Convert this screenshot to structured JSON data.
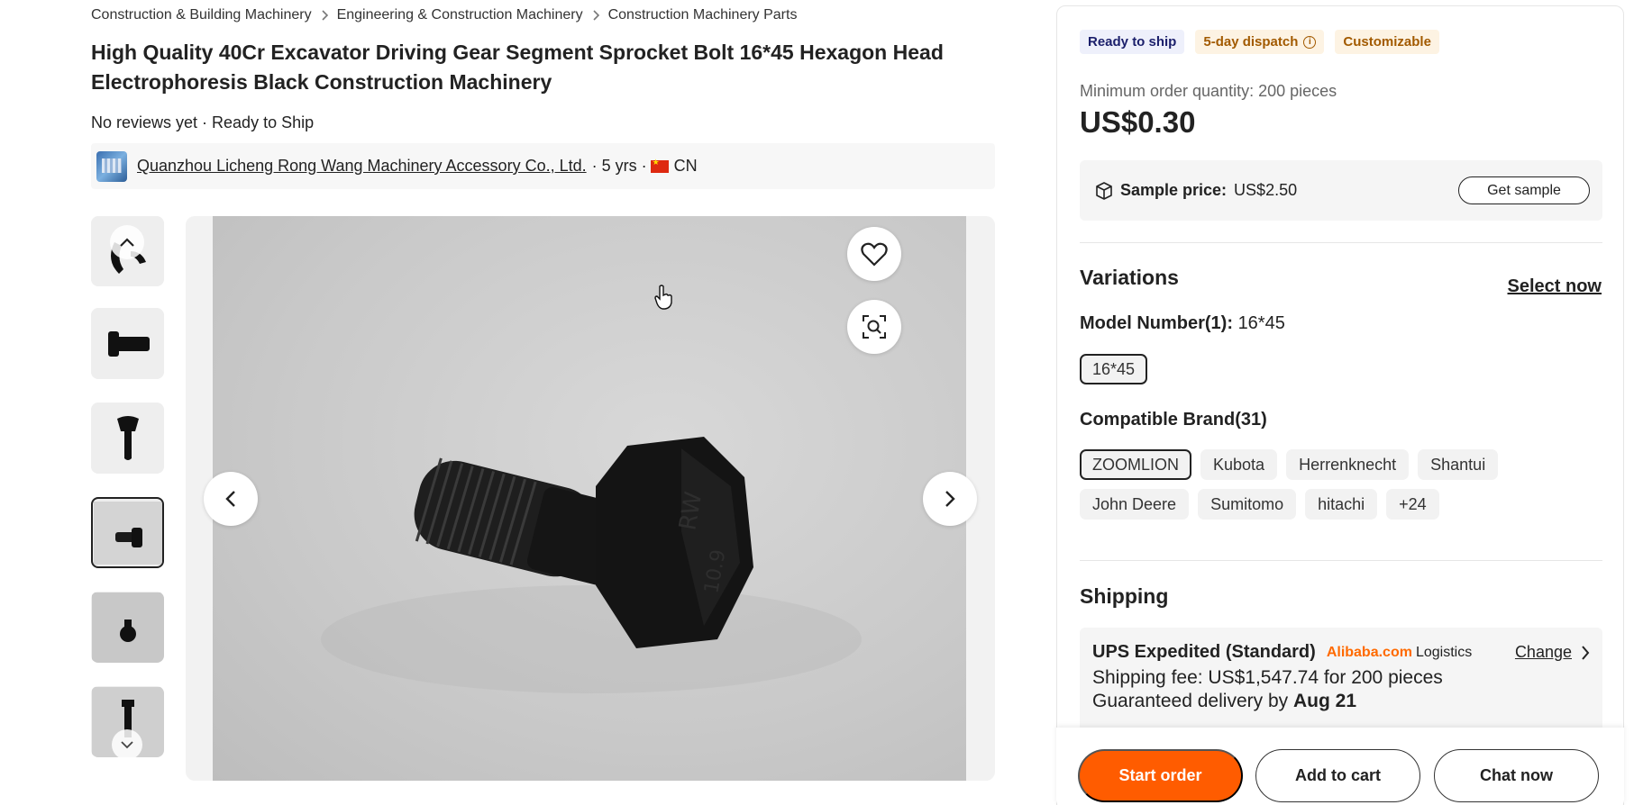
{
  "breadcrumb": [
    "Construction & Building Machinery",
    "Engineering & Construction Machinery",
    "Construction Machinery Parts"
  ],
  "product": {
    "title": "High Quality 40Cr Excavator Driving Gear Segment Sprocket Bolt 16*45 Hexagon Head Electrophoresis Black Construction Machinery",
    "reviews": "No reviews yet · Ready to Ship"
  },
  "supplier": {
    "name": "Quanzhou Licheng Rong Wang Machinery Accessory Co., Ltd.",
    "meta_years": "· 5 yrs ·",
    "country": "CN"
  },
  "gallery": {
    "favorite_icon": "heart-icon",
    "image_search_icon": "image-search-icon",
    "thumbnails_count": 6,
    "active_thumbnail": 4
  },
  "panel": {
    "badges": {
      "ready": "Ready to ship",
      "dispatch": "5-day dispatch",
      "custom": "Customizable"
    },
    "moq": "Minimum order quantity: 200 pieces",
    "price": "US$0.30",
    "sample": {
      "label": "Sample price:",
      "value": "US$2.50",
      "button": "Get sample"
    },
    "variations": {
      "title": "Variations",
      "select_now": "Select now",
      "model_label": "Model Number(1):",
      "model_value": "16*45",
      "models": [
        "16*45"
      ],
      "brand_label": "Compatible Brand(31)",
      "brands": [
        "ZOOMLION",
        "Kubota",
        "Herrenknecht",
        "Shantui",
        "John Deere",
        "Sumitomo",
        "hitachi",
        "+24"
      ]
    },
    "shipping": {
      "title": "Shipping",
      "method": "UPS Expedited (Standard)",
      "brand": "Alibaba.com",
      "brand_suffix": "Logistics",
      "change": "Change",
      "fee": "Shipping fee: US$1,547.74 for 200 pieces",
      "delivery_prefix": "Guaranteed delivery by",
      "delivery_date": "Aug 21"
    }
  },
  "actions": {
    "start": "Start order",
    "cart": "Add to cart",
    "chat": "Chat now"
  },
  "colors": {
    "accent": "#ff5c00",
    "ship_badge_bg": "#eef0fb",
    "warm_badge_bg": "#fdf3e3",
    "alibaba_orange": "#ff6a00"
  }
}
